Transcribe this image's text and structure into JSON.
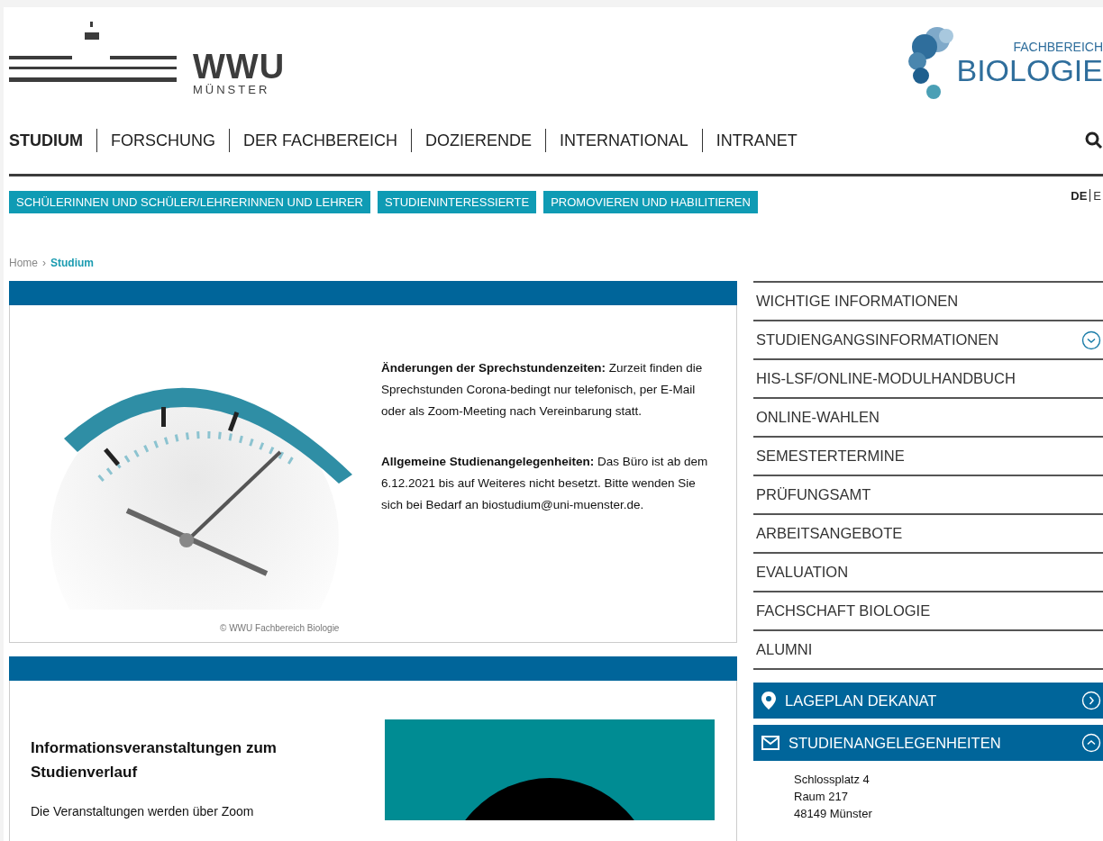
{
  "header": {
    "university": {
      "name": "WWU",
      "city": "MÜNSTER"
    },
    "department": {
      "label": "FACHBEREICH",
      "name": "BIOLOGIE"
    }
  },
  "main_nav": [
    {
      "label": "STUDIUM",
      "selected": true
    },
    {
      "label": "FORSCHUNG",
      "selected": false
    },
    {
      "label": "DER FACHBEREICH",
      "selected": false
    },
    {
      "label": "DOZIERENDE",
      "selected": false
    },
    {
      "label": "INTERNATIONAL",
      "selected": false
    },
    {
      "label": "INTRANET",
      "selected": false
    }
  ],
  "sub_nav": [
    "SCHÜLERINNEN UND SCHÜLER/LEHRERINNEN UND LEHRER",
    "STUDIENINTERESSIERTE",
    "PROMOVIEREN UND HABILITIEREN"
  ],
  "languages": [
    {
      "label": "DE",
      "selected": true
    },
    {
      "label": "E",
      "selected": false
    }
  ],
  "breadcrumb": {
    "separator": "›",
    "items": [
      {
        "label": "Home",
        "selected": false
      },
      {
        "label": "Studium",
        "selected": true
      }
    ]
  },
  "cards": [
    {
      "kind": "notice",
      "caption": "© WWU Fachbereich Biologie",
      "paragraphs": [
        "**Änderungen der Sprechstundenzeiten:** Zurzeit finden die Sprechstunden Corona-bedingt nur telefonisch, per E-Mail oder als Zoom-Meeting nach Vereinbarung statt.",
        "**Allgemeine Studienangelegenheiten:** Das Büro ist ab dem 6.12.2021 bis auf Weiteres nicht besetzt. Bitte wenden Sie sich bei Bedarf an biostudium@uni-muenster.de."
      ]
    },
    {
      "kind": "event",
      "heading": "Informationsveranstaltungen zum Studienverlauf",
      "text": "Die Veranstaltungen werden über Zoom"
    }
  ],
  "side_menu": [
    {
      "label": "WICHTIGE INFORMATIONEN",
      "kind": "link"
    },
    {
      "label": "STUDIENGANGSINFORMATIONEN",
      "kind": "submenu"
    },
    {
      "label": "HIS-LSF/ONLINE-MODULHANDBUCH",
      "kind": "link"
    },
    {
      "label": "ONLINE-WAHLEN",
      "kind": "link"
    },
    {
      "label": "SEMESTERTERMINE",
      "kind": "link"
    },
    {
      "label": "PRÜFUNGSAMT",
      "kind": "link"
    },
    {
      "label": "ARBEITSANGEBOTE",
      "kind": "link"
    },
    {
      "label": "EVALUATION",
      "kind": "link"
    },
    {
      "label": "FACHSCHAFT BIOLOGIE",
      "kind": "link"
    },
    {
      "label": "ALUMNI",
      "kind": "link"
    }
  ],
  "side_boxes": [
    {
      "label": "LAGEPLAN DEKANAT",
      "kind": "pin",
      "expanded": false
    },
    {
      "label": "STUDIENANGELEGENHEITEN",
      "kind": "mail",
      "expanded": true,
      "lines": [
        "Schlossplatz 4",
        "Raum 217",
        "48149 Münster"
      ]
    }
  ]
}
